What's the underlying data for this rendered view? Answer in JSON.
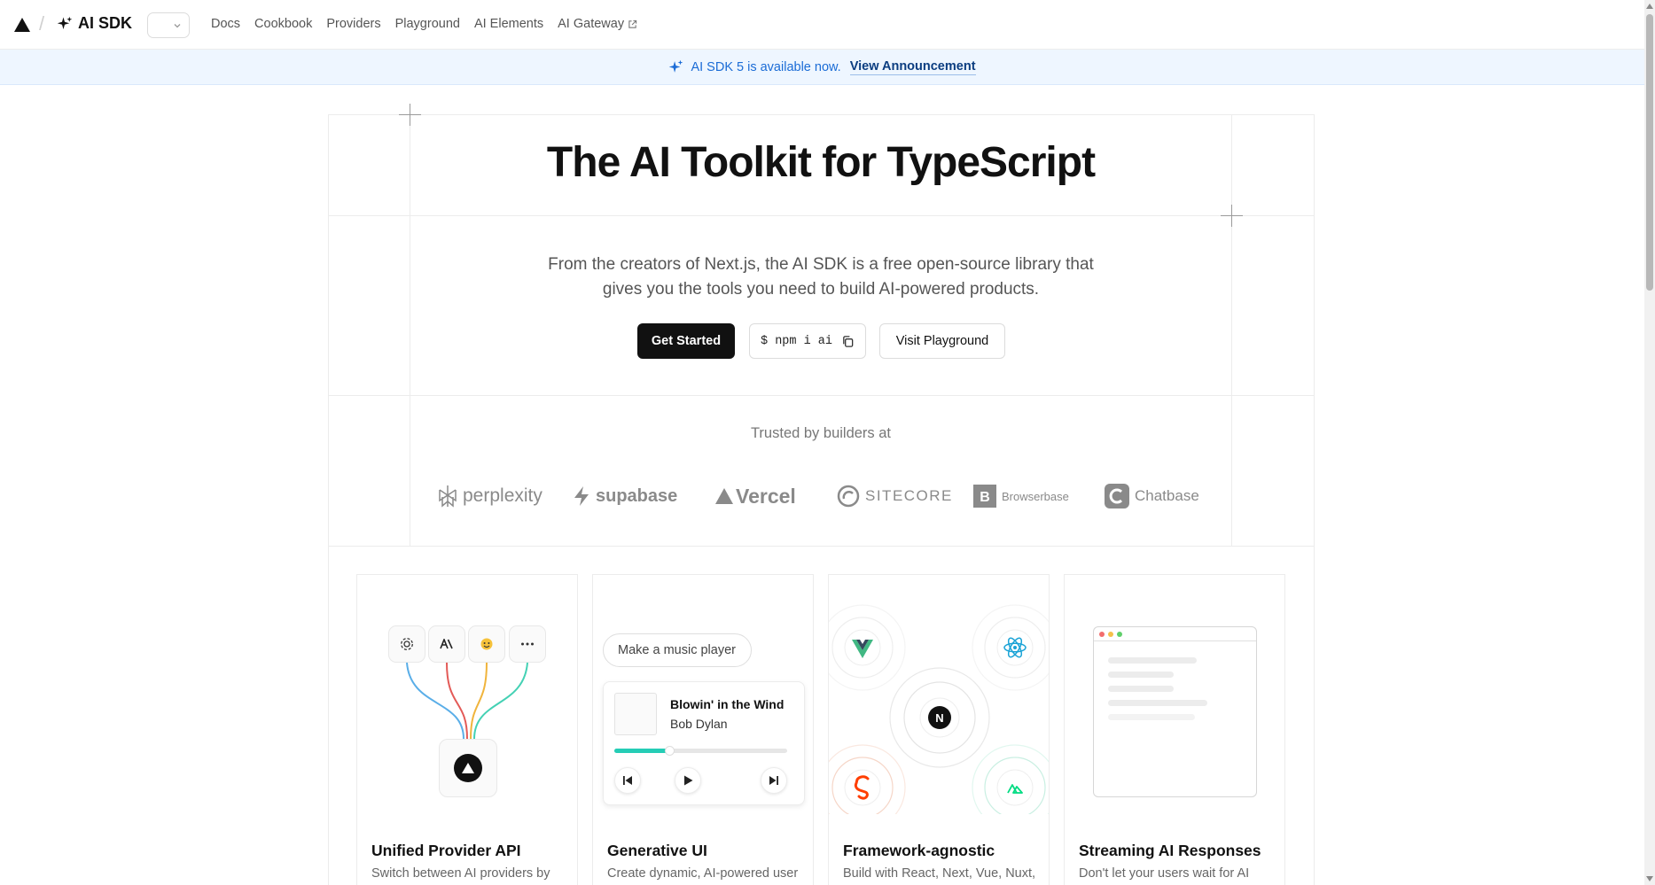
{
  "header": {
    "brand": "AI SDK",
    "nav": [
      {
        "label": "Docs"
      },
      {
        "label": "Cookbook"
      },
      {
        "label": "Providers"
      },
      {
        "label": "Playground"
      },
      {
        "label": "AI Elements"
      },
      {
        "label": "AI Gateway",
        "external": true
      }
    ]
  },
  "banner": {
    "text": "AI SDK 5 is available now.",
    "link": "View Announcement"
  },
  "hero": {
    "title": "The AI Toolkit for TypeScript",
    "description_line1": "From the creators of Next.js, the AI SDK is a free open-source library that",
    "description_line2": "gives you the tools you need to build AI-powered products.",
    "primary_button": "Get Started",
    "install_command": "$ npm i ai",
    "secondary_button": "Visit Playground"
  },
  "trusted": {
    "label": "Trusted by builders at",
    "logos": [
      "perplexity",
      "supabase",
      "Vercel",
      "SITECORE",
      "Browserbase",
      "Chatbase"
    ]
  },
  "features": [
    {
      "title": "Unified Provider API",
      "description": "Switch between AI providers by"
    },
    {
      "title": "Generative UI",
      "description": "Create dynamic, AI-powered user"
    },
    {
      "title": "Framework-agnostic",
      "description": "Build with React, Next, Vue, Nuxt,"
    },
    {
      "title": "Streaming AI Responses",
      "description": "Don't let your users wait for AI"
    }
  ],
  "generative_ui_demo": {
    "prompt": "Make a music player",
    "song": "Blowin' in the Wind",
    "artist": "Bob Dylan",
    "progress": 0.32
  },
  "provider_chips": [
    "openai-icon",
    "anthropic-icon",
    "huggingface-icon",
    "more-icon"
  ],
  "colors": {
    "accent_blue": "#1b6cd6",
    "banner_bg": "#eef6ff",
    "primary": "#111111",
    "teal": "#25cdb6"
  }
}
